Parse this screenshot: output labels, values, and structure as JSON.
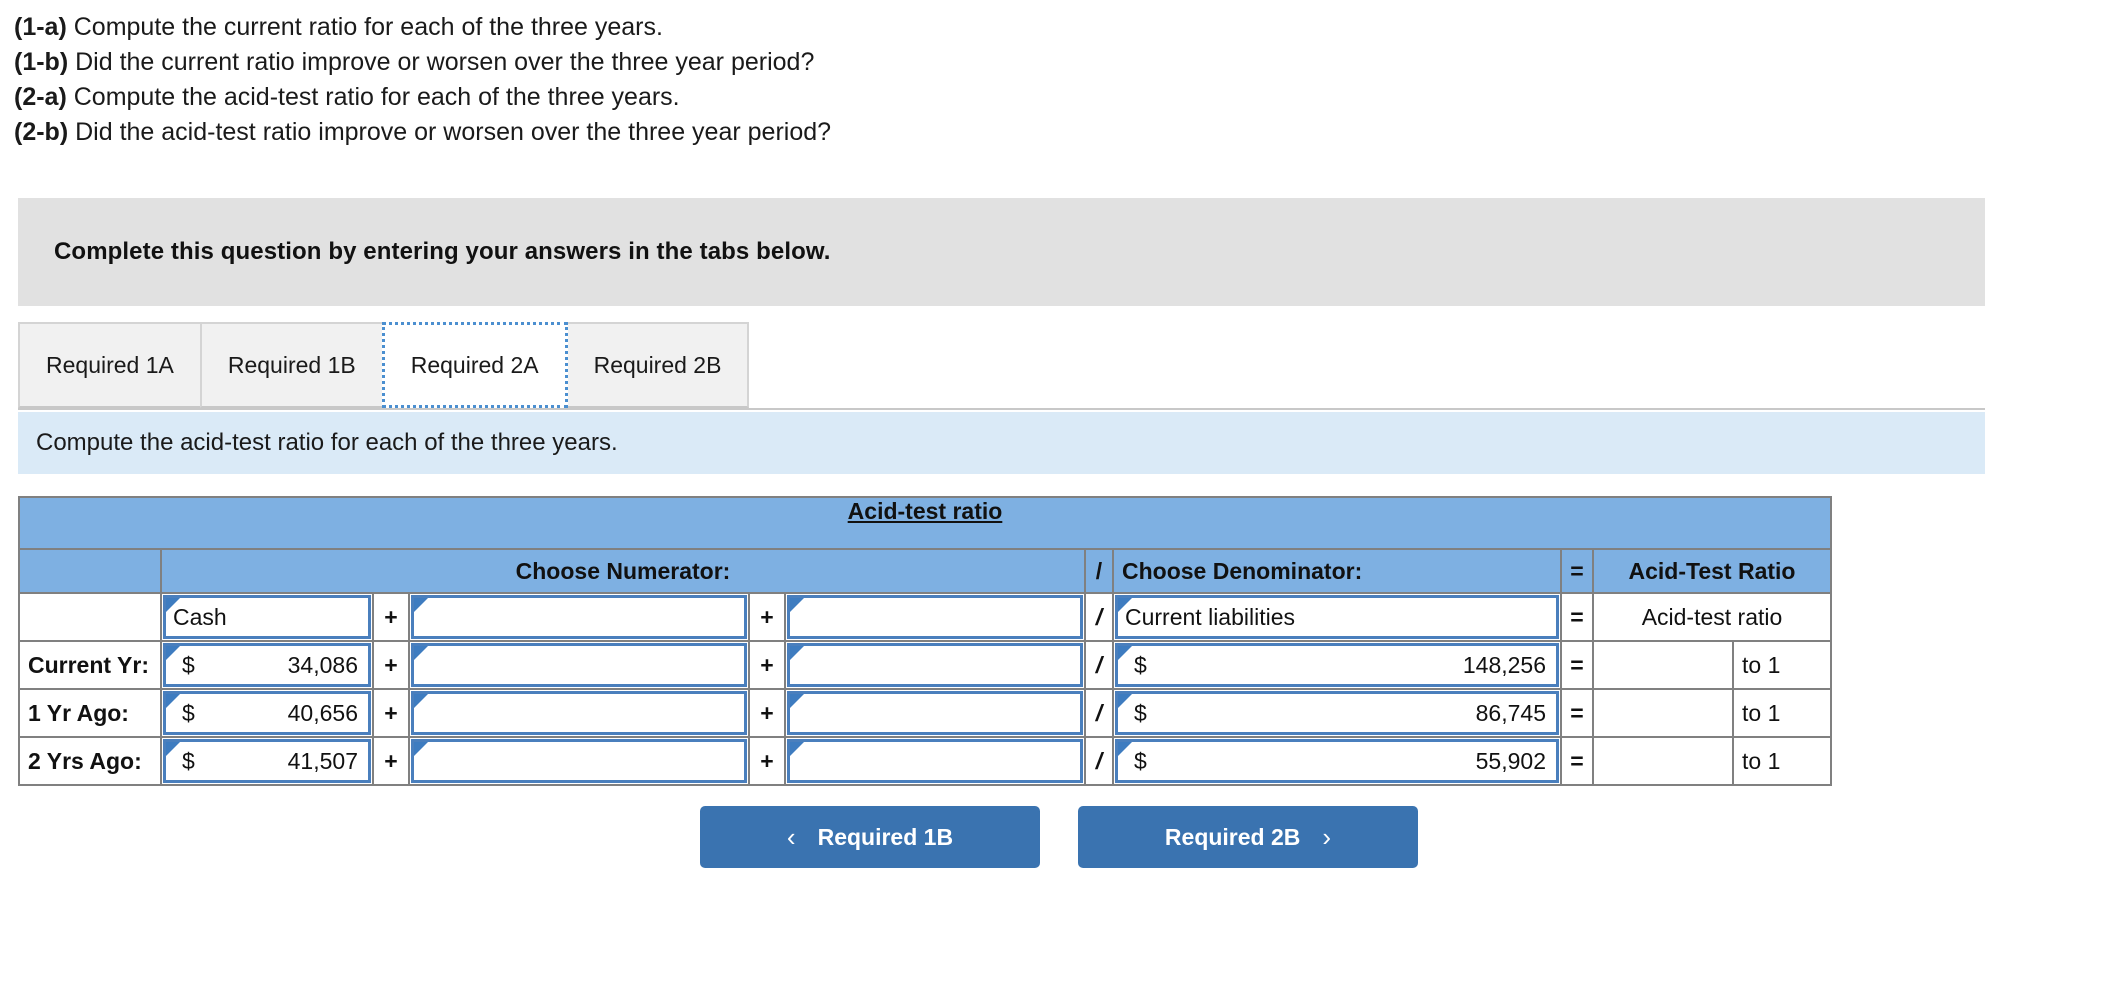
{
  "questions": [
    {
      "tag": "(1-a)",
      "text": "Compute the current ratio for each of the three years."
    },
    {
      "tag": "(1-b)",
      "text": "Did the current ratio improve or worsen over the three year period?"
    },
    {
      "tag": "(2-a)",
      "text": "Compute the acid-test ratio for each of the three years."
    },
    {
      "tag": "(2-b)",
      "text": "Did the acid-test ratio improve or worsen over the three year period?"
    }
  ],
  "instruction_banner": {
    "text": "Complete this question by entering your answers in the tabs below."
  },
  "tabs": [
    {
      "label": "Required 1A",
      "active": false
    },
    {
      "label": "Required 1B",
      "active": false
    },
    {
      "label": "Required 2A",
      "active": true
    },
    {
      "label": "Required 2B",
      "active": false
    }
  ],
  "sub_instruction": {
    "text": "Compute the acid-test ratio for each of the three years."
  },
  "table": {
    "title": "Acid-test ratio",
    "headers": {
      "numerator": "Choose Numerator:",
      "divider": "/",
      "denominator": "Choose Denominator:",
      "equals": "=",
      "result": "Acid-Test Ratio"
    },
    "label_row": {
      "rowlabel": "",
      "num1": "Cash",
      "plus1": "+",
      "num2": "",
      "plus2": "+",
      "num3": "",
      "slash": "/",
      "denom": "Current liabilities",
      "equals": "=",
      "result": "Acid-test ratio"
    },
    "rows": [
      {
        "label": "Current Yr:",
        "num1_currency": "$",
        "num1_value": "34,086",
        "plus1": "+",
        "num2_value": "",
        "plus2": "+",
        "num3_value": "",
        "slash": "/",
        "denom_currency": "$",
        "denom_value": "148,256",
        "equals": "=",
        "ratio_value": "",
        "ratio_suffix": "to 1"
      },
      {
        "label": "1 Yr Ago:",
        "num1_currency": "$",
        "num1_value": "40,656",
        "plus1": "+",
        "num2_value": "",
        "plus2": "+",
        "num3_value": "",
        "slash": "/",
        "denom_currency": "$",
        "denom_value": "86,745",
        "equals": "=",
        "ratio_value": "",
        "ratio_suffix": "to 1"
      },
      {
        "label": "2 Yrs Ago:",
        "num1_currency": "$",
        "num1_value": "41,507",
        "plus1": "+",
        "num2_value": "",
        "plus2": "+",
        "num3_value": "",
        "slash": "/",
        "denom_currency": "$",
        "denom_value": "55,902",
        "equals": "=",
        "ratio_value": "",
        "ratio_suffix": "to 1"
      }
    ]
  },
  "nav": {
    "prev_label": "Required 1B",
    "prev_icon": "chevron-left",
    "prev_chevron": "‹",
    "next_label": "Required 2B",
    "next_icon": "chevron-right",
    "next_chevron": "›"
  },
  "colors": {
    "header_blue": "#7eb0e2",
    "sub_instruction_blue": "#daeaf7",
    "banner_gray": "#e1e1e1",
    "button_blue": "#3a73b0",
    "input_border_blue": "#4a7fbd"
  }
}
